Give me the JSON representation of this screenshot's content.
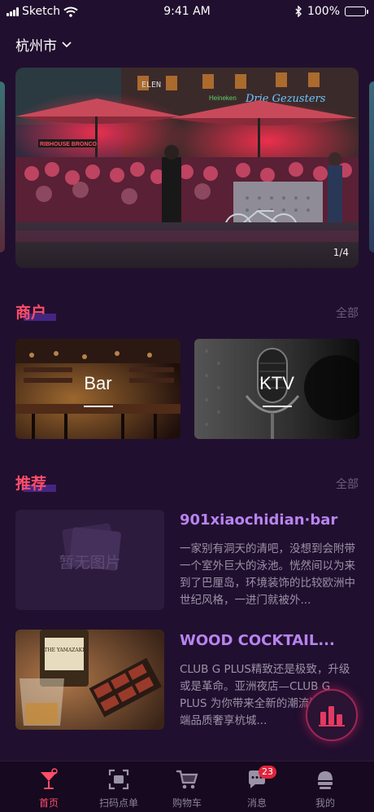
{
  "status_bar": {
    "carrier": "Sketch",
    "time": "9:41 AM",
    "battery": "100%"
  },
  "header": {
    "city": "杭州市"
  },
  "banner": {
    "counter": "1/4",
    "signs": [
      "RIBHOUSE BRONCO",
      "Heineken",
      "Drie Gezusters",
      "ELEN"
    ]
  },
  "merchants": {
    "title": "商户",
    "more": "全部",
    "cards": [
      {
        "label": "Bar"
      },
      {
        "label": "KTV"
      }
    ]
  },
  "recommend": {
    "title": "推荐",
    "more": "全部",
    "items": [
      {
        "image_placeholder": "暂无图片",
        "title": "901xiaochidian·bar",
        "description": "一家别有洞天的清吧，没想到会附带一个室外巨大的泳池。恍然间以为来到了巴厘岛，环境装饰的比较欧洲中世纪风格，一进门就被外..."
      },
      {
        "title": "WOOD COCKTAIL...",
        "description": "CLUB G PLUS精致还是极致，升级或是革命。亚洲夜店—CLUB G PLUS 为你带来全新的潮流巅峰，高端品质奢享杭城...",
        "image_label": "THE YAMAZAKI"
      }
    ]
  },
  "tabbar": {
    "items": [
      {
        "label": "首页",
        "icon": "cocktail-icon"
      },
      {
        "label": "扫码点单",
        "icon": "scan-icon"
      },
      {
        "label": "购物车",
        "icon": "cart-icon"
      },
      {
        "label": "消息",
        "icon": "message-icon",
        "badge": "23"
      },
      {
        "label": "我的",
        "icon": "profile-icon"
      }
    ]
  },
  "colors": {
    "background": "#210f2f",
    "accent": "#ff4d6a",
    "title_purple": "#b784f0",
    "muted_text": "#9c92a8"
  }
}
